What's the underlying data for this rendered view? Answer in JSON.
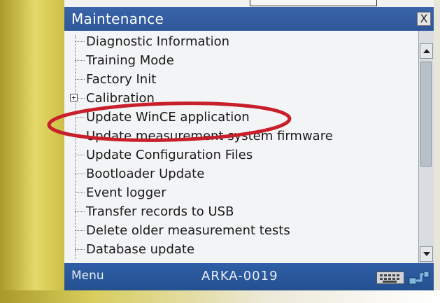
{
  "window": {
    "title": "Maintenance",
    "close_label": "X"
  },
  "tree": {
    "items": [
      {
        "label": "Diagnostic Information",
        "expandable": false
      },
      {
        "label": "Training Mode",
        "expandable": false
      },
      {
        "label": "Factory Init",
        "expandable": false
      },
      {
        "label": "Calibration",
        "expandable": true,
        "expander_symbol": "+"
      },
      {
        "label": "Update WinCE application",
        "expandable": false,
        "highlighted": true
      },
      {
        "label": "Update measurement system firmware",
        "expandable": false
      },
      {
        "label": "Update Configuration Files",
        "expandable": false
      },
      {
        "label": "Bootloader Update",
        "expandable": false
      },
      {
        "label": "Event logger",
        "expandable": false
      },
      {
        "label": "Transfer records to USB",
        "expandable": false
      },
      {
        "label": "Delete older measurement tests",
        "expandable": false
      },
      {
        "label": "Database update",
        "expandable": false
      }
    ]
  },
  "bottombar": {
    "menu_label": "Menu",
    "device_id": "ARKA-0019"
  },
  "icons": {
    "close": "close-icon",
    "scroll_up": "chevron-up-icon",
    "scroll_down": "chevron-down-icon",
    "keyboard": "keyboard-icon",
    "connection": "connector-icon"
  },
  "colors": {
    "titlebar": "#2d5799",
    "bottombar": "#24508f",
    "list_background": "#f3f4f6",
    "highlight_ring": "#c8202a",
    "bezel": "#d8cc52"
  }
}
